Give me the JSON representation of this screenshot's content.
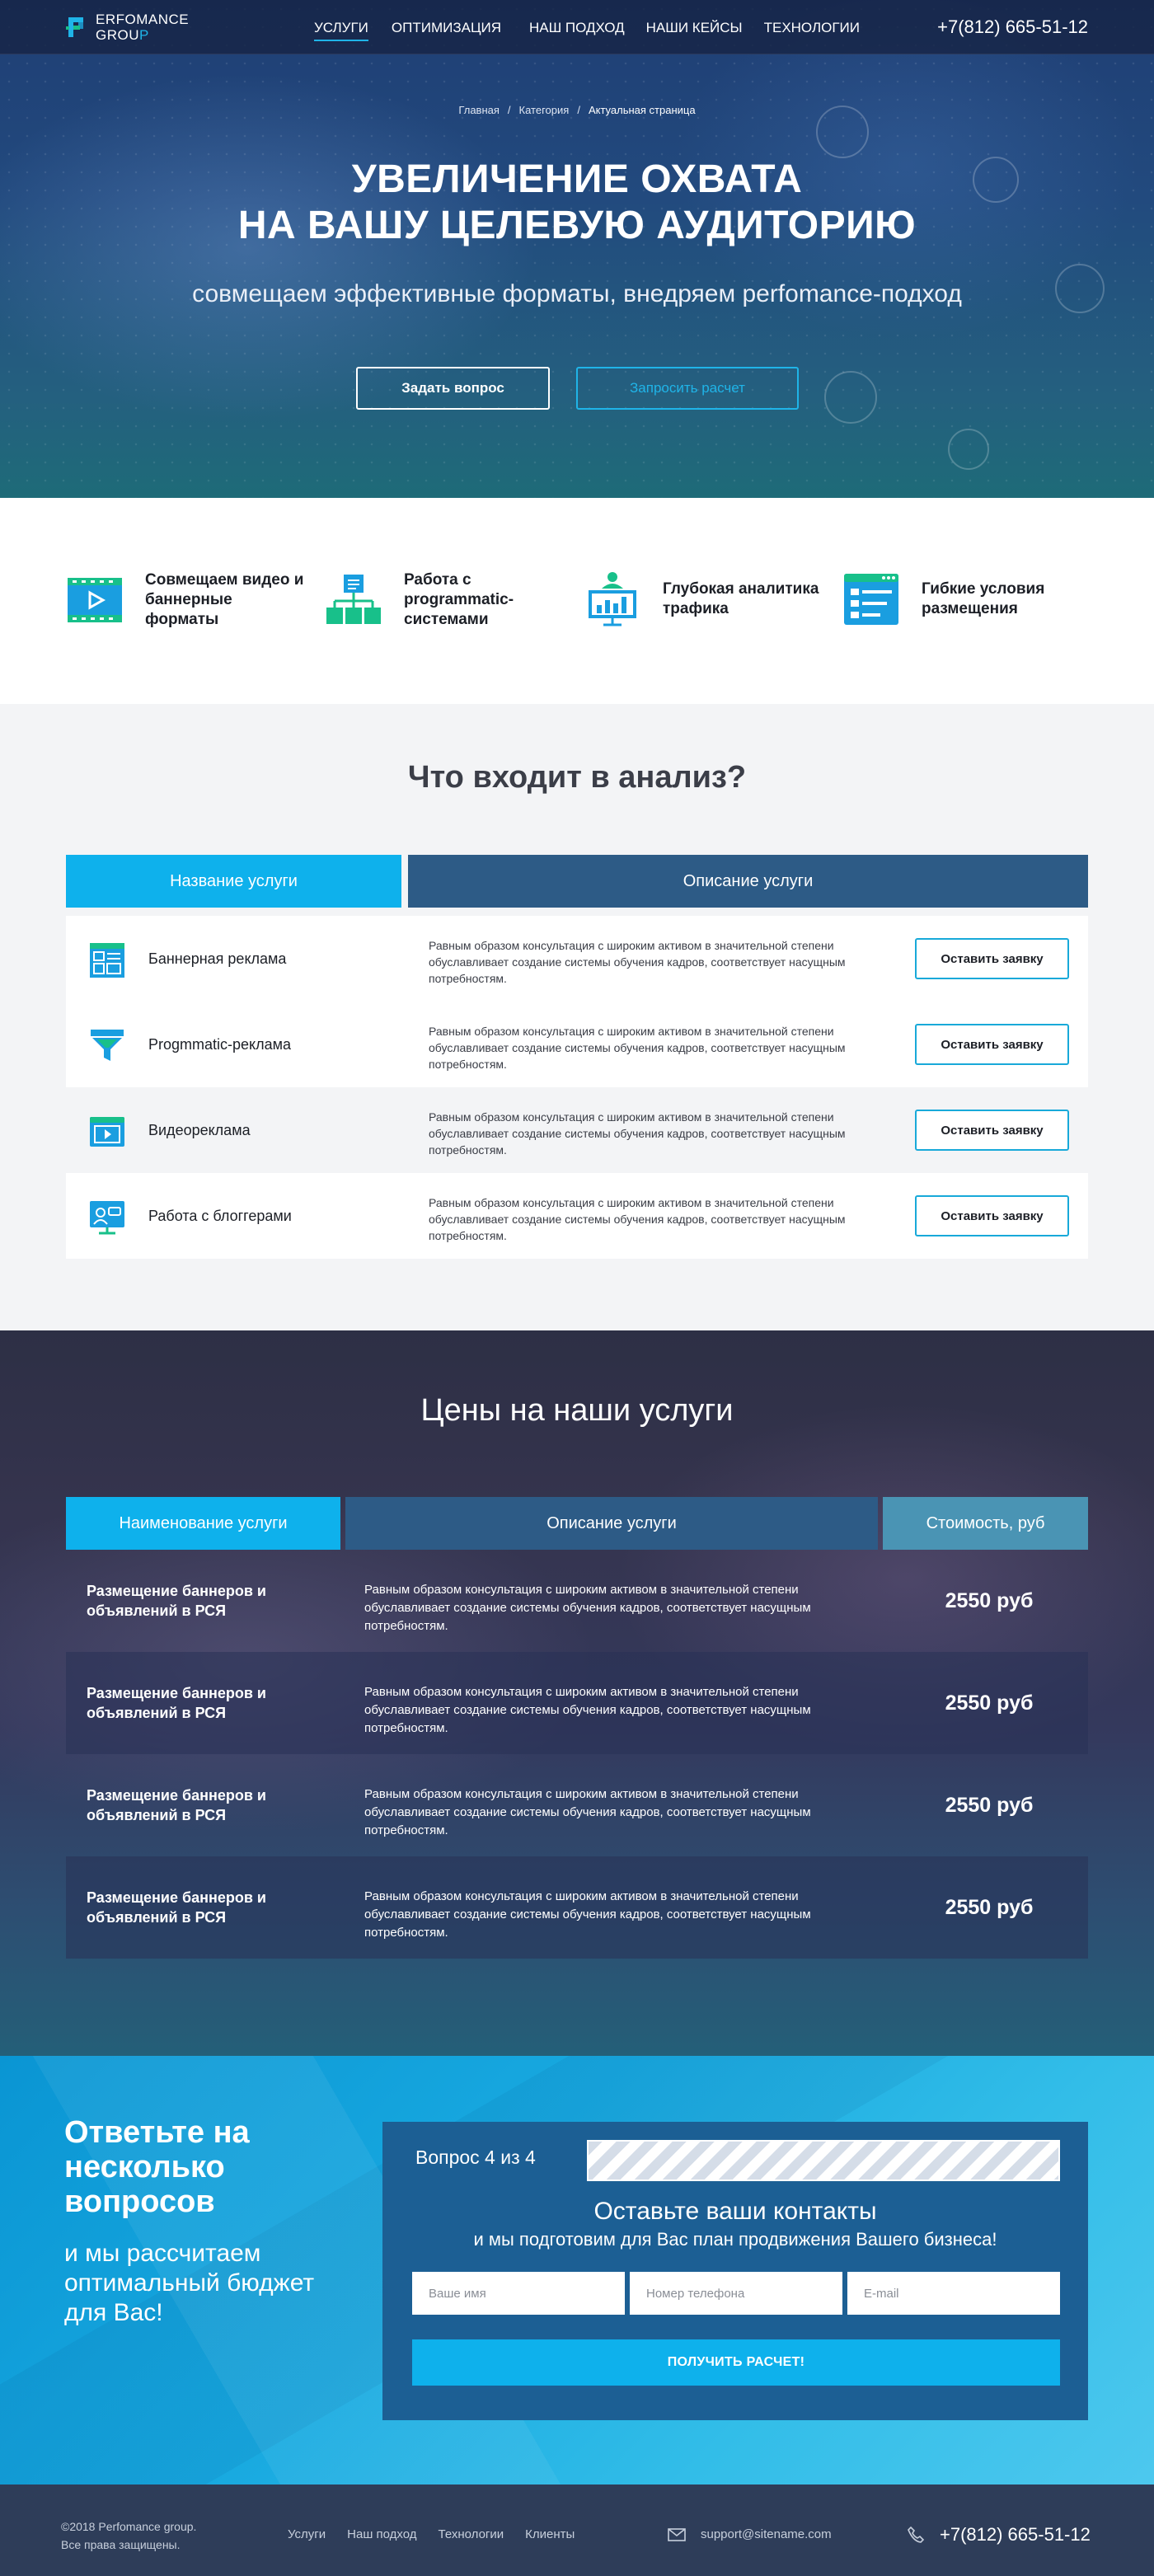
{
  "header": {
    "logo_line1": "ERFOMANCE",
    "logo_line2": "GROU",
    "logo_line2_accent": "P",
    "nav": [
      "УСЛУГИ",
      "ОПТИМИЗАЦИЯ",
      "НАШ ПОДХОД",
      "НАШИ КЕЙСЫ",
      "ТЕХНОЛОГИИ"
    ],
    "phone": "+7(812) 665-51-12"
  },
  "hero": {
    "breadcrumbs": [
      "Главная",
      "Категория",
      "Актуальная страница"
    ],
    "breadcrumb_sep": "/",
    "title_line1": "УВЕЛИЧЕНИЕ ОХВАТА",
    "title_line2": "НА ВАШУ ЦЕЛЕВУЮ АУДИТОРИЮ",
    "subtitle": "совмещаем эффективные форматы, внедряем perfomance-подход",
    "btn_ask": "Задать вопрос",
    "btn_calc": "Запросить расчет"
  },
  "features": [
    {
      "icon": "video-banner-icon",
      "label": "Совмещаем видео и баннерные форматы"
    },
    {
      "icon": "hierarchy-icon",
      "label": "Работа с programmatic-системами"
    },
    {
      "icon": "presentation-chart-icon",
      "label": "Глубокая аналитика трафика"
    },
    {
      "icon": "browser-window-icon",
      "label": "Гибкие условия размещения"
    }
  ],
  "analysis": {
    "title": "Что входит в анализ?",
    "col_name": "Название услуги",
    "col_desc": "Описание услуги",
    "button": "Оставить заявку",
    "rows": [
      {
        "icon": "banner-icon",
        "name": "Баннерная реклама",
        "desc": "Равным образом консультация с широким активом в значительной степени обуславливает создание системы обучения кадров, соответствует насущным потребностям."
      },
      {
        "icon": "funnel-icon",
        "name": "Progmmatic-реклама",
        "desc": "Равным образом консультация с широким активом в значительной степени обуславливает создание системы обучения кадров, соответствует насущным потребностям."
      },
      {
        "icon": "video-player-icon",
        "name": "Видеореклама",
        "desc": "Равным образом консультация с широким активом в значительной степени обуславливает создание системы обучения кадров, соответствует насущным потребностям."
      },
      {
        "icon": "blogger-icon",
        "name": "Работа с блоггерами",
        "desc": "Равным образом консультация с широким активом в значительной степени обуславливает создание системы обучения кадров, соответствует насущным потребностям."
      }
    ]
  },
  "prices": {
    "title": "Цены на наши услуги",
    "col_name": "Наименование услуги",
    "col_desc": "Описание услуги",
    "col_price": "Стоимость, руб",
    "rows": [
      {
        "name": "Размещение баннеров  и объявлений в РСЯ",
        "desc": "Равным образом консультация с широким активом в значительной степени обуславливает создание системы обучения кадров, соответствует насущным потребностям.",
        "price": "2550 руб"
      },
      {
        "name": "Размещение баннеров  и объявлений в РСЯ",
        "desc": "Равным образом консультация с широким активом в значительной степени обуславливает создание системы обучения кадров, соответствует насущным потребностям.",
        "price": "2550 руб"
      },
      {
        "name": "Размещение баннеров  и объявлений в РСЯ",
        "desc": "Равным образом консультация с широким активом в значительной степени обуславливает создание системы обучения кадров, соответствует насущным потребностям.",
        "price": "2550 руб"
      },
      {
        "name": "Размещение баннеров  и объявлений в РСЯ",
        "desc": "Равным образом консультация с широким активом в значительной степени обуславливает создание системы обучения кадров, соответствует насущным потребностям.",
        "price": "2550 руб"
      }
    ]
  },
  "quiz": {
    "title": "Ответьте на несколько вопросов",
    "subtitle": "и мы рассчитаем оптимальный бюджет для Вас!",
    "step": "Вопрос 4 из 4",
    "progress": 1.0,
    "heading": "Оставьте ваши контакты",
    "subheading": "и мы подготовим для Вас план продвижения Вашего бизнеса!",
    "name_placeholder": "Ваше имя",
    "phone_placeholder": "Номер телефона",
    "email_placeholder": "E-mail",
    "submit": "ПОЛУЧИТЬ РАСЧЕТ!"
  },
  "footer": {
    "copy_line1": "©2018 Perfomance group.",
    "copy_line2": "Все права защищены.",
    "nav": [
      "Услуги",
      "Наш подход",
      "Технологии",
      "Клиенты"
    ],
    "email": "support@sitename.com",
    "phone": "+7(812) 665-51-12"
  },
  "colors": {
    "accent": "#1fb4e8",
    "dark_blue": "#2d5b86",
    "footer": "#2e3d59",
    "icon_green": "#18c08a",
    "icon_blue": "#1a9ee0"
  }
}
